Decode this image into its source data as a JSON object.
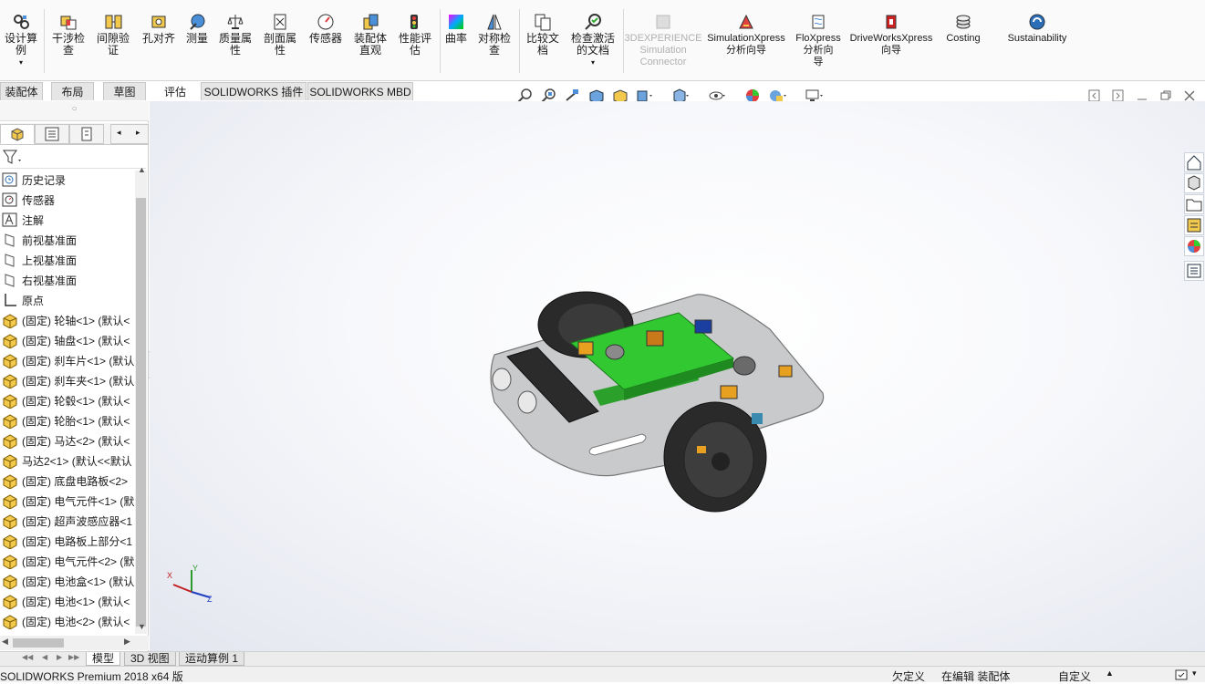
{
  "ribbon": {
    "buttons": [
      {
        "id": "design-calc",
        "label": "设计算\n例",
        "dropdown": true
      },
      {
        "id": "interference",
        "label": "干涉检\n查"
      },
      {
        "id": "clearance",
        "label": "间隙验\n证"
      },
      {
        "id": "hole-align",
        "label": "孔对齐"
      },
      {
        "id": "measure",
        "label": "测量"
      },
      {
        "id": "mass-props",
        "label": "质量属\n性"
      },
      {
        "id": "section-props",
        "label": "剖面属\n性"
      },
      {
        "id": "sensor",
        "label": "传感器"
      },
      {
        "id": "assembly-visual",
        "label": "装配体\n直观"
      },
      {
        "id": "performance",
        "label": "性能评\n估"
      },
      {
        "id": "curvature",
        "label": "曲率"
      },
      {
        "id": "symmetry",
        "label": "对称检\n查"
      },
      {
        "id": "compare",
        "label": "比较文\n档"
      },
      {
        "id": "check-active",
        "label": "检查激活\n的文档",
        "dropdown": true
      },
      {
        "id": "3dx",
        "label": "3DEXPERIENCE\nSimulation\nConnector",
        "disabled": true
      },
      {
        "id": "simxpress",
        "label": "SimulationXpress\n分析向导"
      },
      {
        "id": "floxpress",
        "label": "FloXpress\n分析向\n导"
      },
      {
        "id": "driveworks",
        "label": "DriveWorksXpress\n向导"
      },
      {
        "id": "costing",
        "label": "Costing"
      },
      {
        "id": "sustainability",
        "label": "Sustainability"
      }
    ]
  },
  "tabs": {
    "left": [
      "装配体",
      "布局",
      "草图"
    ],
    "main": [
      "评估",
      "SOLIDWORKS 插件",
      "SOLIDWORKS MBD"
    ],
    "active": "评估"
  },
  "tree": {
    "items": [
      {
        "label": "历史记录",
        "icon": "history-icon"
      },
      {
        "label": "传感器",
        "icon": "sensor-icon"
      },
      {
        "label": "注解",
        "icon": "annotation-icon"
      },
      {
        "label": "前视基准面",
        "icon": "plane-icon"
      },
      {
        "label": "上视基准面",
        "icon": "plane-icon"
      },
      {
        "label": "右视基准面",
        "icon": "plane-icon"
      },
      {
        "label": "原点",
        "icon": "origin-icon"
      },
      {
        "label": "(固定) 轮轴<1> (默认<",
        "icon": "part-icon"
      },
      {
        "label": "(固定) 轴盘<1> (默认<",
        "icon": "part-icon"
      },
      {
        "label": "(固定) 刹车片<1> (默认",
        "icon": "part-icon"
      },
      {
        "label": "(固定) 刹车夹<1> (默认",
        "icon": "part-icon"
      },
      {
        "label": "(固定) 轮毂<1> (默认<",
        "icon": "part-icon"
      },
      {
        "label": "(固定) 轮胎<1> (默认<",
        "icon": "part-icon"
      },
      {
        "label": "(固定) 马达<2> (默认<",
        "icon": "part-icon"
      },
      {
        "label": "马达2<1> (默认<<默认",
        "icon": "part-icon"
      },
      {
        "label": "(固定) 底盘电路板<2>",
        "icon": "part-icon"
      },
      {
        "label": "(固定) 电气元件<1> (默",
        "icon": "part-icon"
      },
      {
        "label": "(固定) 超声波感应器<1",
        "icon": "part-icon"
      },
      {
        "label": "(固定) 电路板上部分<1",
        "icon": "part-icon"
      },
      {
        "label": "(固定) 电气元件<2> (默",
        "icon": "part-icon"
      },
      {
        "label": "(固定) 电池盒<1> (默认",
        "icon": "part-icon"
      },
      {
        "label": "(固定) 电池<1> (默认<",
        "icon": "part-icon"
      },
      {
        "label": "(固定) 电池<2> (默认<",
        "icon": "part-icon"
      }
    ]
  },
  "bottom_tabs": [
    "模型",
    "3D 视图",
    "运动算例 1"
  ],
  "bottom_active": "模型",
  "triad": {
    "x": "X",
    "y": "Y",
    "z": "Z"
  },
  "status": {
    "app": "SOLIDWORKS Premium 2018 x64 版",
    "state": "欠定义",
    "editing": "在编辑 装配体",
    "units": "自定义"
  },
  "colors": {
    "pcb": "#32c832",
    "plate": "#c9cacc",
    "tire": "#2a2a2a",
    "accent": "#e8a020"
  }
}
